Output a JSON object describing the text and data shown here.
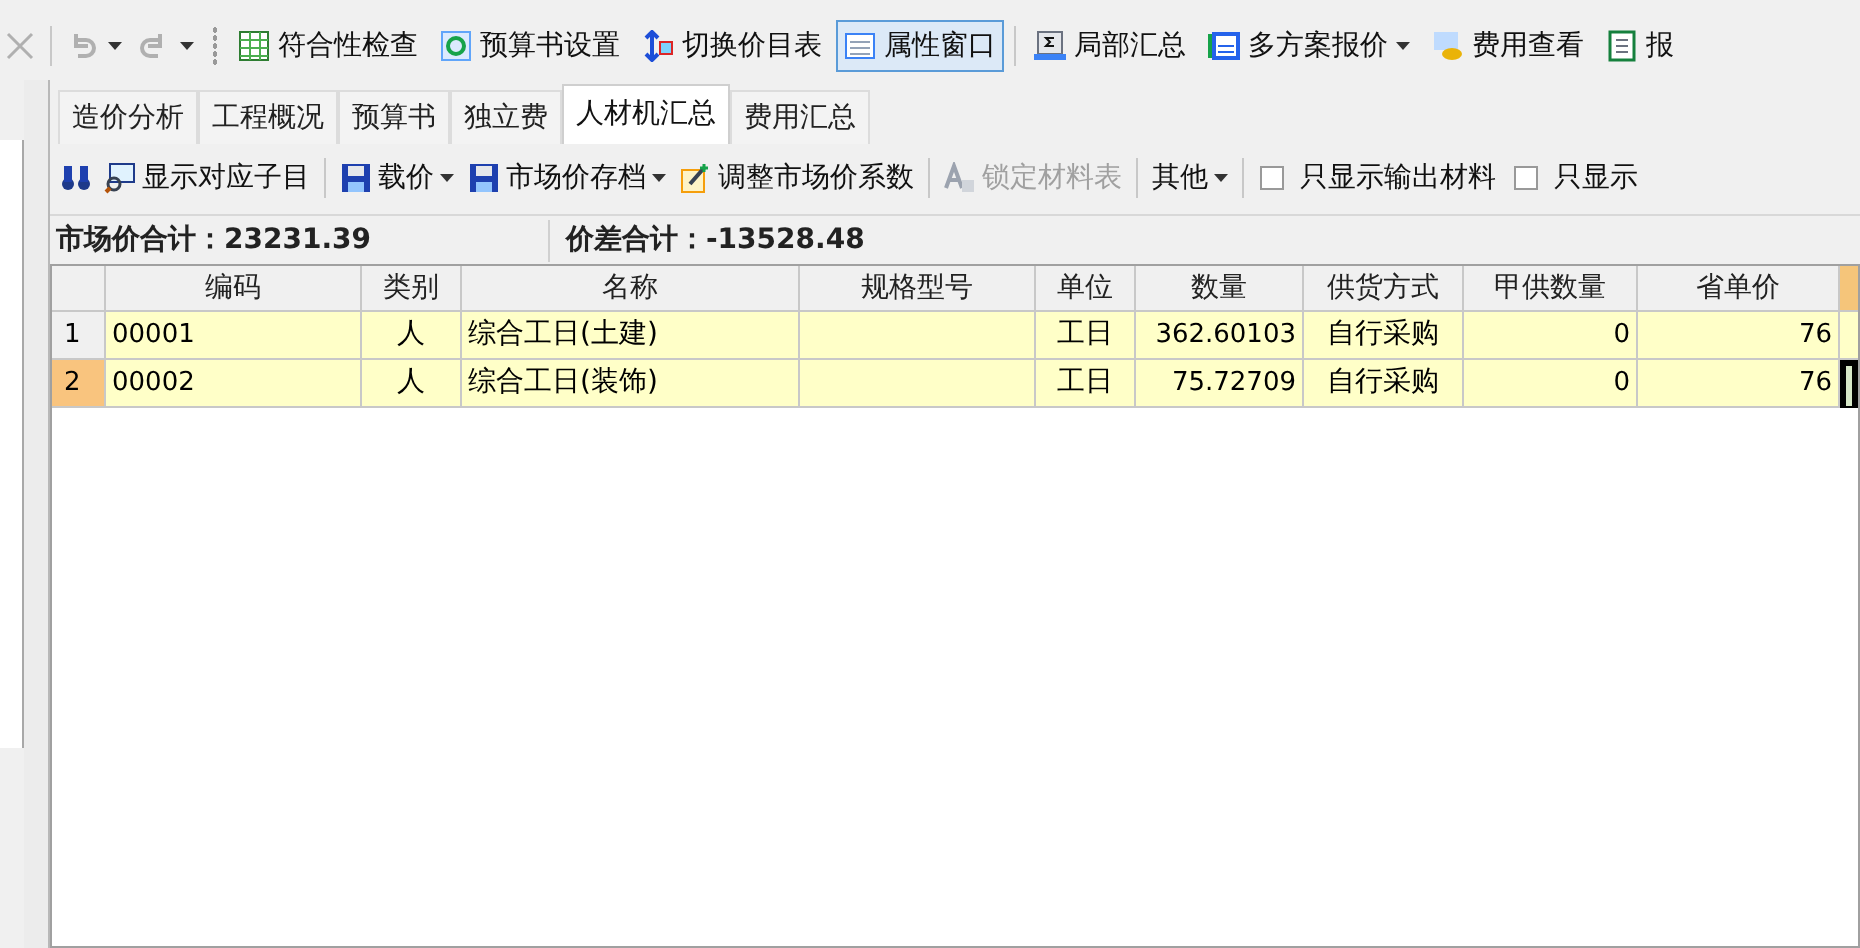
{
  "toolbar": {
    "items": [
      {
        "kind": "close",
        "disabled": true
      },
      {
        "kind": "undo",
        "disabled": true
      },
      {
        "kind": "redo",
        "disabled": true
      },
      {
        "kind": "button",
        "label": "符合性检查",
        "pressed": false,
        "dropdown": false
      },
      {
        "kind": "button",
        "label": "预算书设置",
        "pressed": false,
        "dropdown": false
      },
      {
        "kind": "button",
        "label": "切换价目表",
        "pressed": false,
        "dropdown": false
      },
      {
        "kind": "button",
        "label": "属性窗口",
        "pressed": true,
        "dropdown": false
      },
      {
        "kind": "button",
        "label": "局部汇总",
        "pressed": false,
        "dropdown": false
      },
      {
        "kind": "button",
        "label": "多方案报价",
        "pressed": false,
        "dropdown": true
      },
      {
        "kind": "button",
        "label": "费用查看",
        "pressed": false,
        "dropdown": false
      },
      {
        "kind": "button",
        "label": "报",
        "pressed": false,
        "dropdown": false
      }
    ]
  },
  "tabs": [
    {
      "label": "造价分析",
      "selected": false
    },
    {
      "label": "工程概况",
      "selected": false
    },
    {
      "label": "预算书",
      "selected": false
    },
    {
      "label": "独立费",
      "selected": false
    },
    {
      "label": "人材机汇总",
      "selected": true
    },
    {
      "label": "费用汇总",
      "selected": false
    }
  ],
  "subtoolbar": [
    {
      "kind": "icon"
    },
    {
      "kind": "button",
      "label": "显示对应子目",
      "dropdown": false,
      "disabled": false
    },
    {
      "kind": "button",
      "label": "载价",
      "dropdown": true,
      "disabled": false
    },
    {
      "kind": "button",
      "label": "市场价存档",
      "dropdown": true,
      "disabled": false
    },
    {
      "kind": "button",
      "label": "调整市场价系数",
      "dropdown": false,
      "disabled": false
    },
    {
      "kind": "button",
      "label": "锁定材料表",
      "dropdown": false,
      "disabled": true
    },
    {
      "kind": "button",
      "label": "其他",
      "dropdown": true,
      "disabled": false
    },
    {
      "kind": "checkbox",
      "label": "只显示输出材料",
      "checked": false
    },
    {
      "kind": "checkbox",
      "label": "只显示",
      "checked": false
    }
  ],
  "summary": [
    "市场价合计：23231.39",
    "价差合计：-13528.48"
  ],
  "table": {
    "columns": [
      "编码",
      "类别",
      "名称",
      "规格型号",
      "单位",
      "数量",
      "供货方式",
      "甲供数量",
      "省单价"
    ],
    "rows": [
      {
        "number": "1",
        "selected": false,
        "cells": [
          "00001",
          "人",
          "综合工日(土建)",
          "",
          "工日",
          "362.60103",
          "自行采购",
          "0",
          "76"
        ]
      },
      {
        "number": "2",
        "selected": true,
        "cells": [
          "00002",
          "人",
          "综合工日(装饰)",
          "",
          "工日",
          "75.72709",
          "自行采购",
          "0",
          "76"
        ]
      }
    ]
  }
}
